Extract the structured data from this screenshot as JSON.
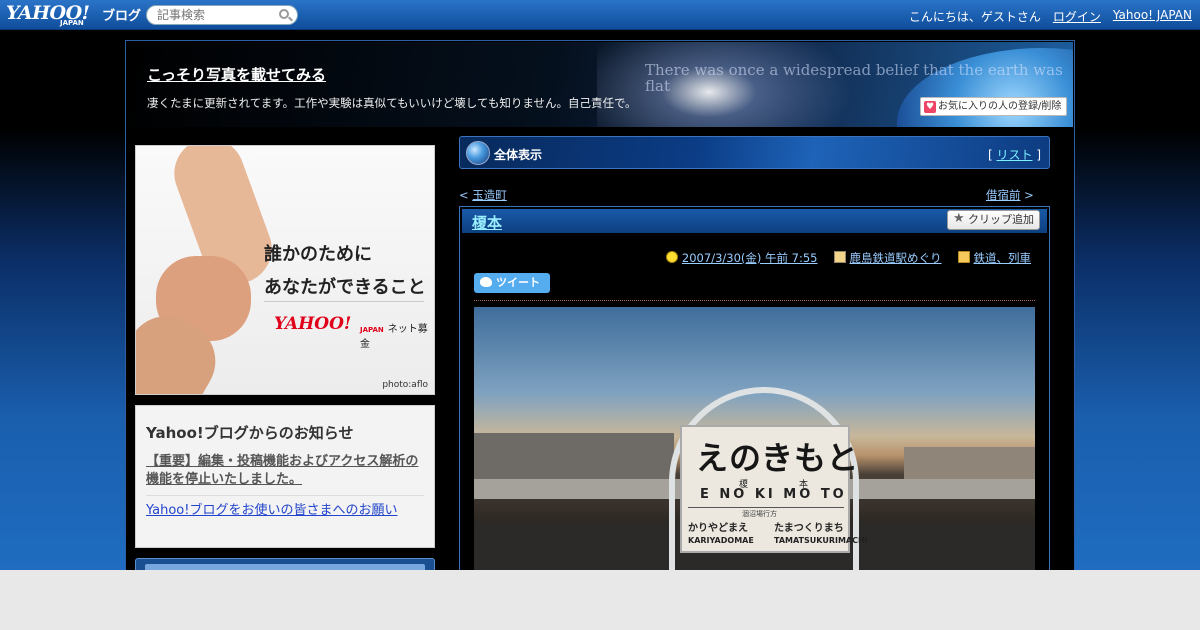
{
  "topbar": {
    "logo": "YAHOO!",
    "logo_sub": "JAPAN",
    "logo_blog": "ブログ",
    "search_placeholder": "記事検索",
    "greeting": "こんにちは、ゲストさん",
    "login": "ログイン",
    "yahoo_japan": "Yahoo! JAPAN"
  },
  "blog": {
    "title": "こっそり写真を載せてみる",
    "description": "凄くたまに更新されてます。工作や実験は真似てもいいけど壊しても知りません。自己責任で。",
    "motto": "There was once a widespread belief that the earth was flat",
    "fav_button": "お気に入りの人の登録/削除"
  },
  "sidebar": {
    "ad": {
      "copy_line1": "誰かのために",
      "copy_line2": "あなたができること",
      "brand": "YAHOO!",
      "brand_sub": "JAPAN",
      "service": "ネット募金",
      "credit": "photo:aflo"
    },
    "notice": {
      "title": "Yahoo!ブログからのお知らせ",
      "items": [
        "【重要】編集・投稿機能およびアクセス解析の機能を停止いたしました。",
        "Yahoo!ブログをお使いの皆さまへのお願い"
      ]
    }
  },
  "main": {
    "all_view": "全体表示",
    "list_link": "リスト",
    "list_open": "[ ",
    "list_close": " ]",
    "prev_link": "玉造町",
    "next_link": "借宿前",
    "article": {
      "title": "榎本",
      "clip_button": "クリップ追加",
      "date": "2007/3/30(金) 午前 7:55",
      "book": "鹿島鉄道駅めぐり",
      "category": "鉄道、列車",
      "tweet": "ツイート"
    },
    "photo_sign": {
      "hiragana": "えのきもと",
      "kanji_left": "榎",
      "kanji_right": "本",
      "roman": "E NO KI MO TO",
      "direction": "涸沼場行方",
      "left_station": "かりやどまえ",
      "left_roman": "KARIYADOMAE",
      "right_station": "たまつくりまち",
      "right_roman": "TAMATSUKURIMACHI"
    }
  }
}
